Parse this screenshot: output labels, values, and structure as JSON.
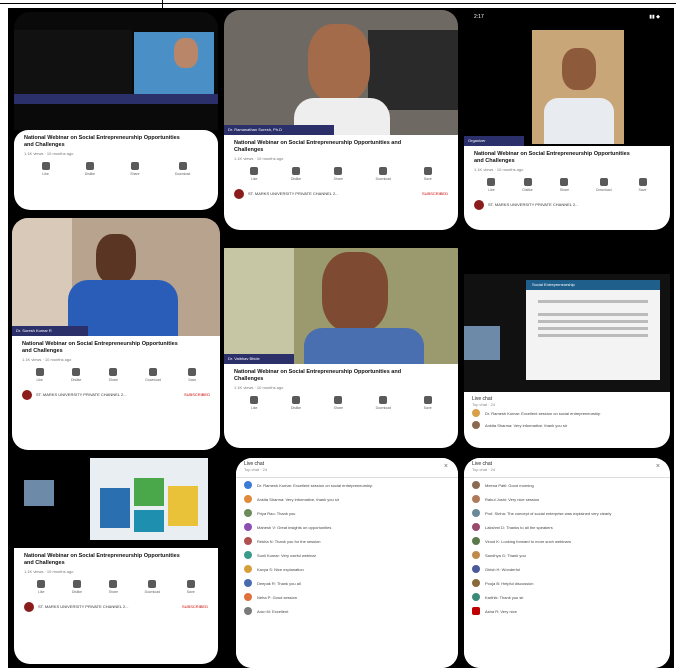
{
  "colors": {
    "accent": "#2b2f6a",
    "like_red": "#c00000"
  },
  "webinar_title": "National Webinar on Social Entrepreneurship Opportunities and Challenges",
  "meta_text": "1.1K views · 10 months ago",
  "actions": [
    "Like",
    "Dislike",
    "Share",
    "Download",
    "Save"
  ],
  "channel_name": "ST. MARKS UNIVERSITY PRIVATE CHANNEL 2...",
  "subscribe_label": "SUBSCRIBED",
  "status_time": "2:17",
  "panels": [
    {
      "speaker": "Dr. Ramanathan Suresh, Ph.D"
    },
    {
      "speaker": "Dr. Suresh Kumar R"
    },
    {
      "speaker": "Dr. Vaibhav Bhide"
    },
    {
      "speaker": "Organizer"
    }
  ],
  "chat": {
    "title": "Live chat",
    "subtitle": "Top chat · 24",
    "messages": [
      "Dr. Ramesh Kumar: Excellent session on social entrepreneurship",
      "Ankita Sharma: Very informative, thank you sir",
      "Priya Rao: Thank you",
      "Mahesh V: Great insights on opportunities",
      "Rekha N: Thank you for the session",
      "Sunil Kumar: Very useful webinar",
      "Kavya S: Nice explanation",
      "Deepak R: Thank you all",
      "Neha P: Good session",
      "Arun M: Excellent"
    ],
    "messages2": [
      "Meena Patil: Good morning",
      "Rahul Joshi: Very nice session",
      "Prof. Sinha: The concept of social enterprise was explained very clearly",
      "Lakshmi D: Thanks to all the speakers",
      "Vinod K: Looking forward to more such webinars",
      "Sandhya G: Thank you",
      "Girish H: Wonderful",
      "Pooja B: Helpful discussion",
      "Karthik: Thank you sir",
      "Asha R: Very nice"
    ]
  },
  "slide": {
    "heading": "Social Entrepreneurship"
  }
}
